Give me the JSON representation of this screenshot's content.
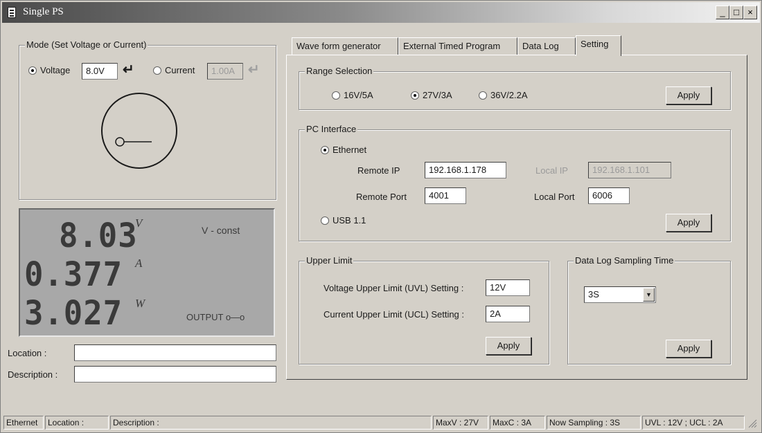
{
  "window": {
    "title": "Single PS",
    "minimize": "_",
    "maximize": "□",
    "close": "×"
  },
  "mode": {
    "group_label": "Mode (Set Voltage or Current)",
    "voltage_label": "Voltage",
    "voltage_value": "8.0V",
    "current_label": "Current",
    "current_value": "1.00A",
    "selected": "voltage"
  },
  "display": {
    "voltage": "8.03",
    "voltage_unit": "V",
    "current": "0.377",
    "current_unit": "A",
    "power": "3.027",
    "power_unit": "W",
    "mode_text": "V - const",
    "output_text": "OUTPUT o—o"
  },
  "info": {
    "location_label": "Location :",
    "location_value": "",
    "description_label": "Description :",
    "description_value": ""
  },
  "tabs": [
    {
      "label": "Wave form generator",
      "active": false
    },
    {
      "label": "External Timed Program",
      "active": false
    },
    {
      "label": "Data Log",
      "active": false
    },
    {
      "label": "Setting",
      "active": true
    }
  ],
  "range": {
    "group_label": "Range Selection",
    "options": [
      "16V/5A",
      "27V/3A",
      "36V/2.2A"
    ],
    "selected": "27V/3A",
    "apply_label": "Apply"
  },
  "pc_interface": {
    "group_label": "PC Interface",
    "ethernet_label": "Ethernet",
    "remote_ip_label": "Remote IP",
    "remote_ip_value": "192.168.1.178",
    "remote_port_label": "Remote Port",
    "remote_port_value": "4001",
    "local_ip_label": "Local IP",
    "local_ip_value": "192.168.1.101",
    "local_port_label": "Local Port",
    "local_port_value": "6006",
    "usb_label": "USB 1.1",
    "selected": "ethernet",
    "apply_label": "Apply"
  },
  "upper_limit": {
    "group_label": "Upper Limit",
    "uvl_label": "Voltage Upper Limit (UVL) Setting :",
    "uvl_value": "12V",
    "ucl_label": "Current Upper Limit (UCL) Setting :",
    "ucl_value": "2A",
    "apply_label": "Apply"
  },
  "sampling": {
    "group_label": "Data Log Sampling Time",
    "selected_value": "3S",
    "apply_label": "Apply"
  },
  "statusbar": {
    "connection": "Ethernet",
    "location": "Location :",
    "description": "Description :",
    "max_v": "MaxV : 27V",
    "max_c": "MaxC : 3A",
    "now_sampling": "Now Sampling : 3S",
    "limits": "UVL : 12V ; UCL : 2A"
  },
  "colors": {
    "face": "#d4d0c8",
    "lcd_bg": "#a8a8a8",
    "lcd_digit": "#3a3a3a"
  }
}
